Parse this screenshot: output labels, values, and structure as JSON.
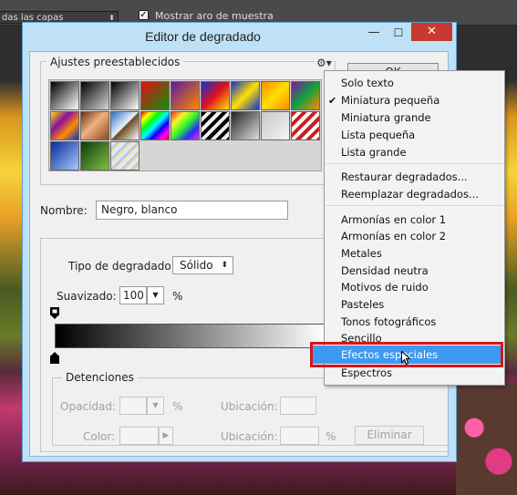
{
  "app": {
    "layers_select": "das las capas",
    "sample_ring_label": "Mostrar aro de muestra"
  },
  "dialog": {
    "title": "Editor de degradado",
    "min_label": "—",
    "max_label": "☐",
    "close_label": "✕",
    "presets_label": "Ajustes preestablecidos",
    "gear_label": "⚙▾",
    "ok_label": "OK",
    "name_label": "Nombre:",
    "name_value": "Negro, blanco",
    "type_label": "Tipo de degradado:",
    "type_value": "Sólido",
    "smooth_label": "Suavizado:",
    "smooth_value": "100",
    "percent": "%",
    "stops_label": "Detenciones",
    "opacity_label": "Opacidad:",
    "location_label": "Ubicación:",
    "color_label": "Color:",
    "delete_label": "Eliminar"
  },
  "presets": [
    {
      "name": "foreground-to-background",
      "css": "linear-gradient(135deg,#000 0%,#fff 100%)"
    },
    {
      "name": "foreground-to-transparent",
      "css": "linear-gradient(135deg,#000 0%,rgba(0,0,0,0) 100%)"
    },
    {
      "name": "black-white",
      "css": "linear-gradient(135deg,#000 0%,#fff 100%)"
    },
    {
      "name": "red-green",
      "css": "linear-gradient(135deg,#e01010 0%,#109010 100%)"
    },
    {
      "name": "violet-orange",
      "css": "linear-gradient(135deg,#5a1a9a 0%,#ff8a00 100%)"
    },
    {
      "name": "blue-red-yellow",
      "css": "linear-gradient(135deg,#1030d0 0%,#e01020 50%,#ffe000 100%)"
    },
    {
      "name": "blue-yellow-blue",
      "css": "linear-gradient(135deg,#1030d0 0%,#ffe000 50%,#1030d0 100%)"
    },
    {
      "name": "orange-yellow-orange",
      "css": "linear-gradient(135deg,#ff8a00 0%,#ffe000 50%,#ff8a00 100%)"
    },
    {
      "name": "violet-green-orange",
      "css": "linear-gradient(135deg,#8a10a0 0%,#10a040 50%,#ff8a00 100%)"
    },
    {
      "name": "yellow-violet-orange-blue",
      "css": "linear-gradient(135deg,#ffe000 0%,#8a10a0 35%,#ff8a00 65%,#1030d0 100%)"
    },
    {
      "name": "copper",
      "css": "linear-gradient(135deg,#6a3010 0%,#f0b080 45%,#8a4a20 100%)"
    },
    {
      "name": "chrome",
      "css": "linear-gradient(135deg,#3070c0 0%,#e8f0ff 48%,#6a4a20 52%,#fff 100%)"
    },
    {
      "name": "spectrum",
      "css": "linear-gradient(135deg,#ff0000,#ffff00,#00ff00,#00ffff,#0000ff,#ff00ff,#ff0000)"
    },
    {
      "name": "transparent-rainbow",
      "css": "linear-gradient(135deg,rgba(255,0,0,.8),rgba(255,255,0,.8),rgba(0,255,0,.8),rgba(0,0,255,.8),rgba(255,0,255,.8))"
    },
    {
      "name": "transparent-stripes",
      "css": "repeating-linear-gradient(135deg,#000 0 4px,#eee 4px 8px)"
    },
    {
      "name": "neutral-density",
      "css": "linear-gradient(135deg,#222 0%,#ddd 100%)"
    },
    {
      "name": "transparent-fade",
      "css": "linear-gradient(135deg,#c8c8c8 0%,#f4f4f4 100%)"
    },
    {
      "name": "red-stripes",
      "css": "repeating-linear-gradient(135deg,#c82020 0 4px,#fff 4px 8px)"
    },
    {
      "name": "blue-light",
      "css": "linear-gradient(135deg,#0a2a9a 0%,#a8c8ff 100%)"
    },
    {
      "name": "green-dark",
      "css": "linear-gradient(135deg,#0a3a0a 0%,#80c040 100%)"
    },
    {
      "name": "pastel-stripes",
      "css": "repeating-linear-gradient(135deg,#e8e8e8 0 4px,#9ad0ff 4px 6px,#ffd090 6px 8px)"
    }
  ],
  "menu": {
    "items": [
      "Solo texto",
      "Miniatura pequeña",
      "Miniatura grande",
      "Lista pequeña",
      "Lista grande",
      "Restaurar degradados...",
      "Reemplazar degradados...",
      "Armonías en color 1",
      "Armonías en color 2",
      "Metales",
      "Densidad neutra",
      "Motivos de ruido",
      "Pasteles",
      "Tonos fotográficos",
      "Sencillo",
      "Efectos especiales",
      "Espectros"
    ],
    "checked": "✔",
    "highlighted": "Efectos especiales"
  },
  "colors": {
    "accent": "#3c9af0",
    "highlight_outline": "#d4171e",
    "close_button": "#c8392f",
    "dialog_frame": "#bfe1f5"
  }
}
